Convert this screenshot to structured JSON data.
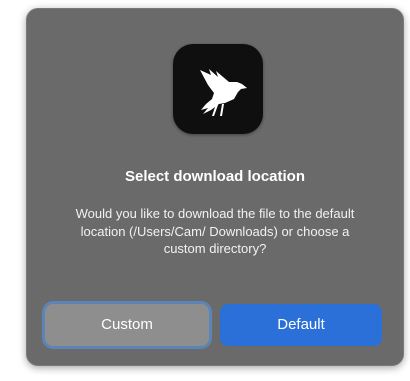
{
  "dialog": {
    "title": "Select download location",
    "message": "Would you like to download the file to the default location (/Users/Cam/ Downloads) or choose a custom directory?",
    "app_icon": "bird-app-icon",
    "buttons": {
      "custom_label": "Custom",
      "default_label": "Default"
    }
  },
  "colors": {
    "dialog_background": "#6a6a6a",
    "app_icon_background": "#0f0f0f",
    "default_button": "#2b70d8",
    "custom_button": "#8e8e8e",
    "focus_ring": "#5b84b7"
  }
}
